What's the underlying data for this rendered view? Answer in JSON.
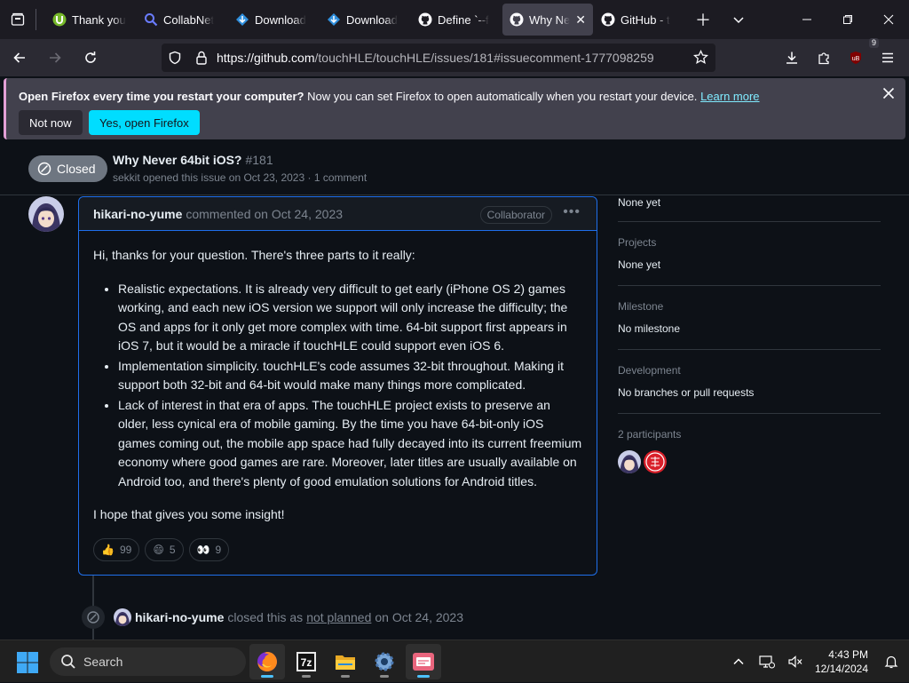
{
  "browser": {
    "tabs": [
      {
        "label": "Thank you",
        "icon": "utorrent-icon",
        "active": false
      },
      {
        "label": "CollabNet",
        "icon": "search-icon",
        "active": false
      },
      {
        "label": "Download",
        "icon": "download-icon",
        "active": false
      },
      {
        "label": "Download",
        "icon": "download-icon",
        "active": false
      },
      {
        "label": "Define `--f",
        "icon": "github-icon",
        "active": false
      },
      {
        "label": "Why Ne",
        "icon": "github-icon",
        "active": true
      },
      {
        "label": "GitHub - t",
        "icon": "github-icon",
        "active": false
      }
    ],
    "url_host": "https://github.com",
    "url_path": "/touchHLE/touchHLE/issues/181#issuecomment-1777098259",
    "extension_badge": "9"
  },
  "notification": {
    "title": "Open Firefox every time you restart your computer?",
    "text": " Now you can set Firefox to open automatically when you restart your device.",
    "link": "Learn more",
    "secondary_button": "Not now",
    "primary_button": "Yes, open Firefox"
  },
  "issue": {
    "state": "Closed",
    "title": "Why Never 64bit iOS?",
    "number": "#181",
    "author": "sekkit",
    "opened_text": "opened this issue on Oct 23, 2023 · 1 comment"
  },
  "comment": {
    "author": "hikari-no-yume",
    "action": "commented on Oct 24, 2023",
    "role": "Collaborator",
    "intro": "Hi, thanks for your question. There's three parts to it really:",
    "bullets": [
      "Realistic expectations. It is already very difficult to get early (iPhone OS 2) games working, and each new iOS version we support will only increase the difficulty; the OS and apps for it only get more complex with time. 64-bit support first appears in iOS 7, but it would be a miracle if touchHLE could support even iOS 6.",
      "Implementation simplicity. touchHLE's code assumes 32-bit throughout. Making it support both 32-bit and 64-bit would make many things more complicated.",
      "Lack of interest in that era of apps. The touchHLE project exists to preserve an older, less cynical era of mobile gaming. By the time you have 64-bit-only iOS games coming out, the mobile app space had fully decayed into its current freemium economy where good games are rare. Moreover, later titles are usually available on Android too, and there's plenty of good emulation solutions for Android titles."
    ],
    "outro": "I hope that gives you some insight!",
    "reactions": [
      {
        "emoji": "👍",
        "count": "99"
      },
      {
        "emoji": "😄",
        "count": "5"
      },
      {
        "emoji": "👀",
        "count": "9"
      }
    ]
  },
  "event": {
    "author": "hikari-no-yume",
    "text_before": "closed this as",
    "reason": "not planned",
    "text_after": "on Oct 24, 2023"
  },
  "sidebar": {
    "top_value": "None yet",
    "projects_title": "Projects",
    "projects_value": "None yet",
    "milestone_title": "Milestone",
    "milestone_value": "No milestone",
    "development_title": "Development",
    "development_value": "No branches or pull requests",
    "participants_title": "2 participants"
  },
  "taskbar": {
    "search_label": "Search",
    "time": "4:43 PM",
    "date": "12/14/2024",
    "apps": [
      "firefox-icon",
      "7zip-icon",
      "file-explorer-icon",
      "settings-icon",
      "app-icon"
    ]
  },
  "colors": {
    "accent_blue": "#1f6feb",
    "closed_gray": "#6e7681",
    "firefox_primary": "#00ddff"
  }
}
